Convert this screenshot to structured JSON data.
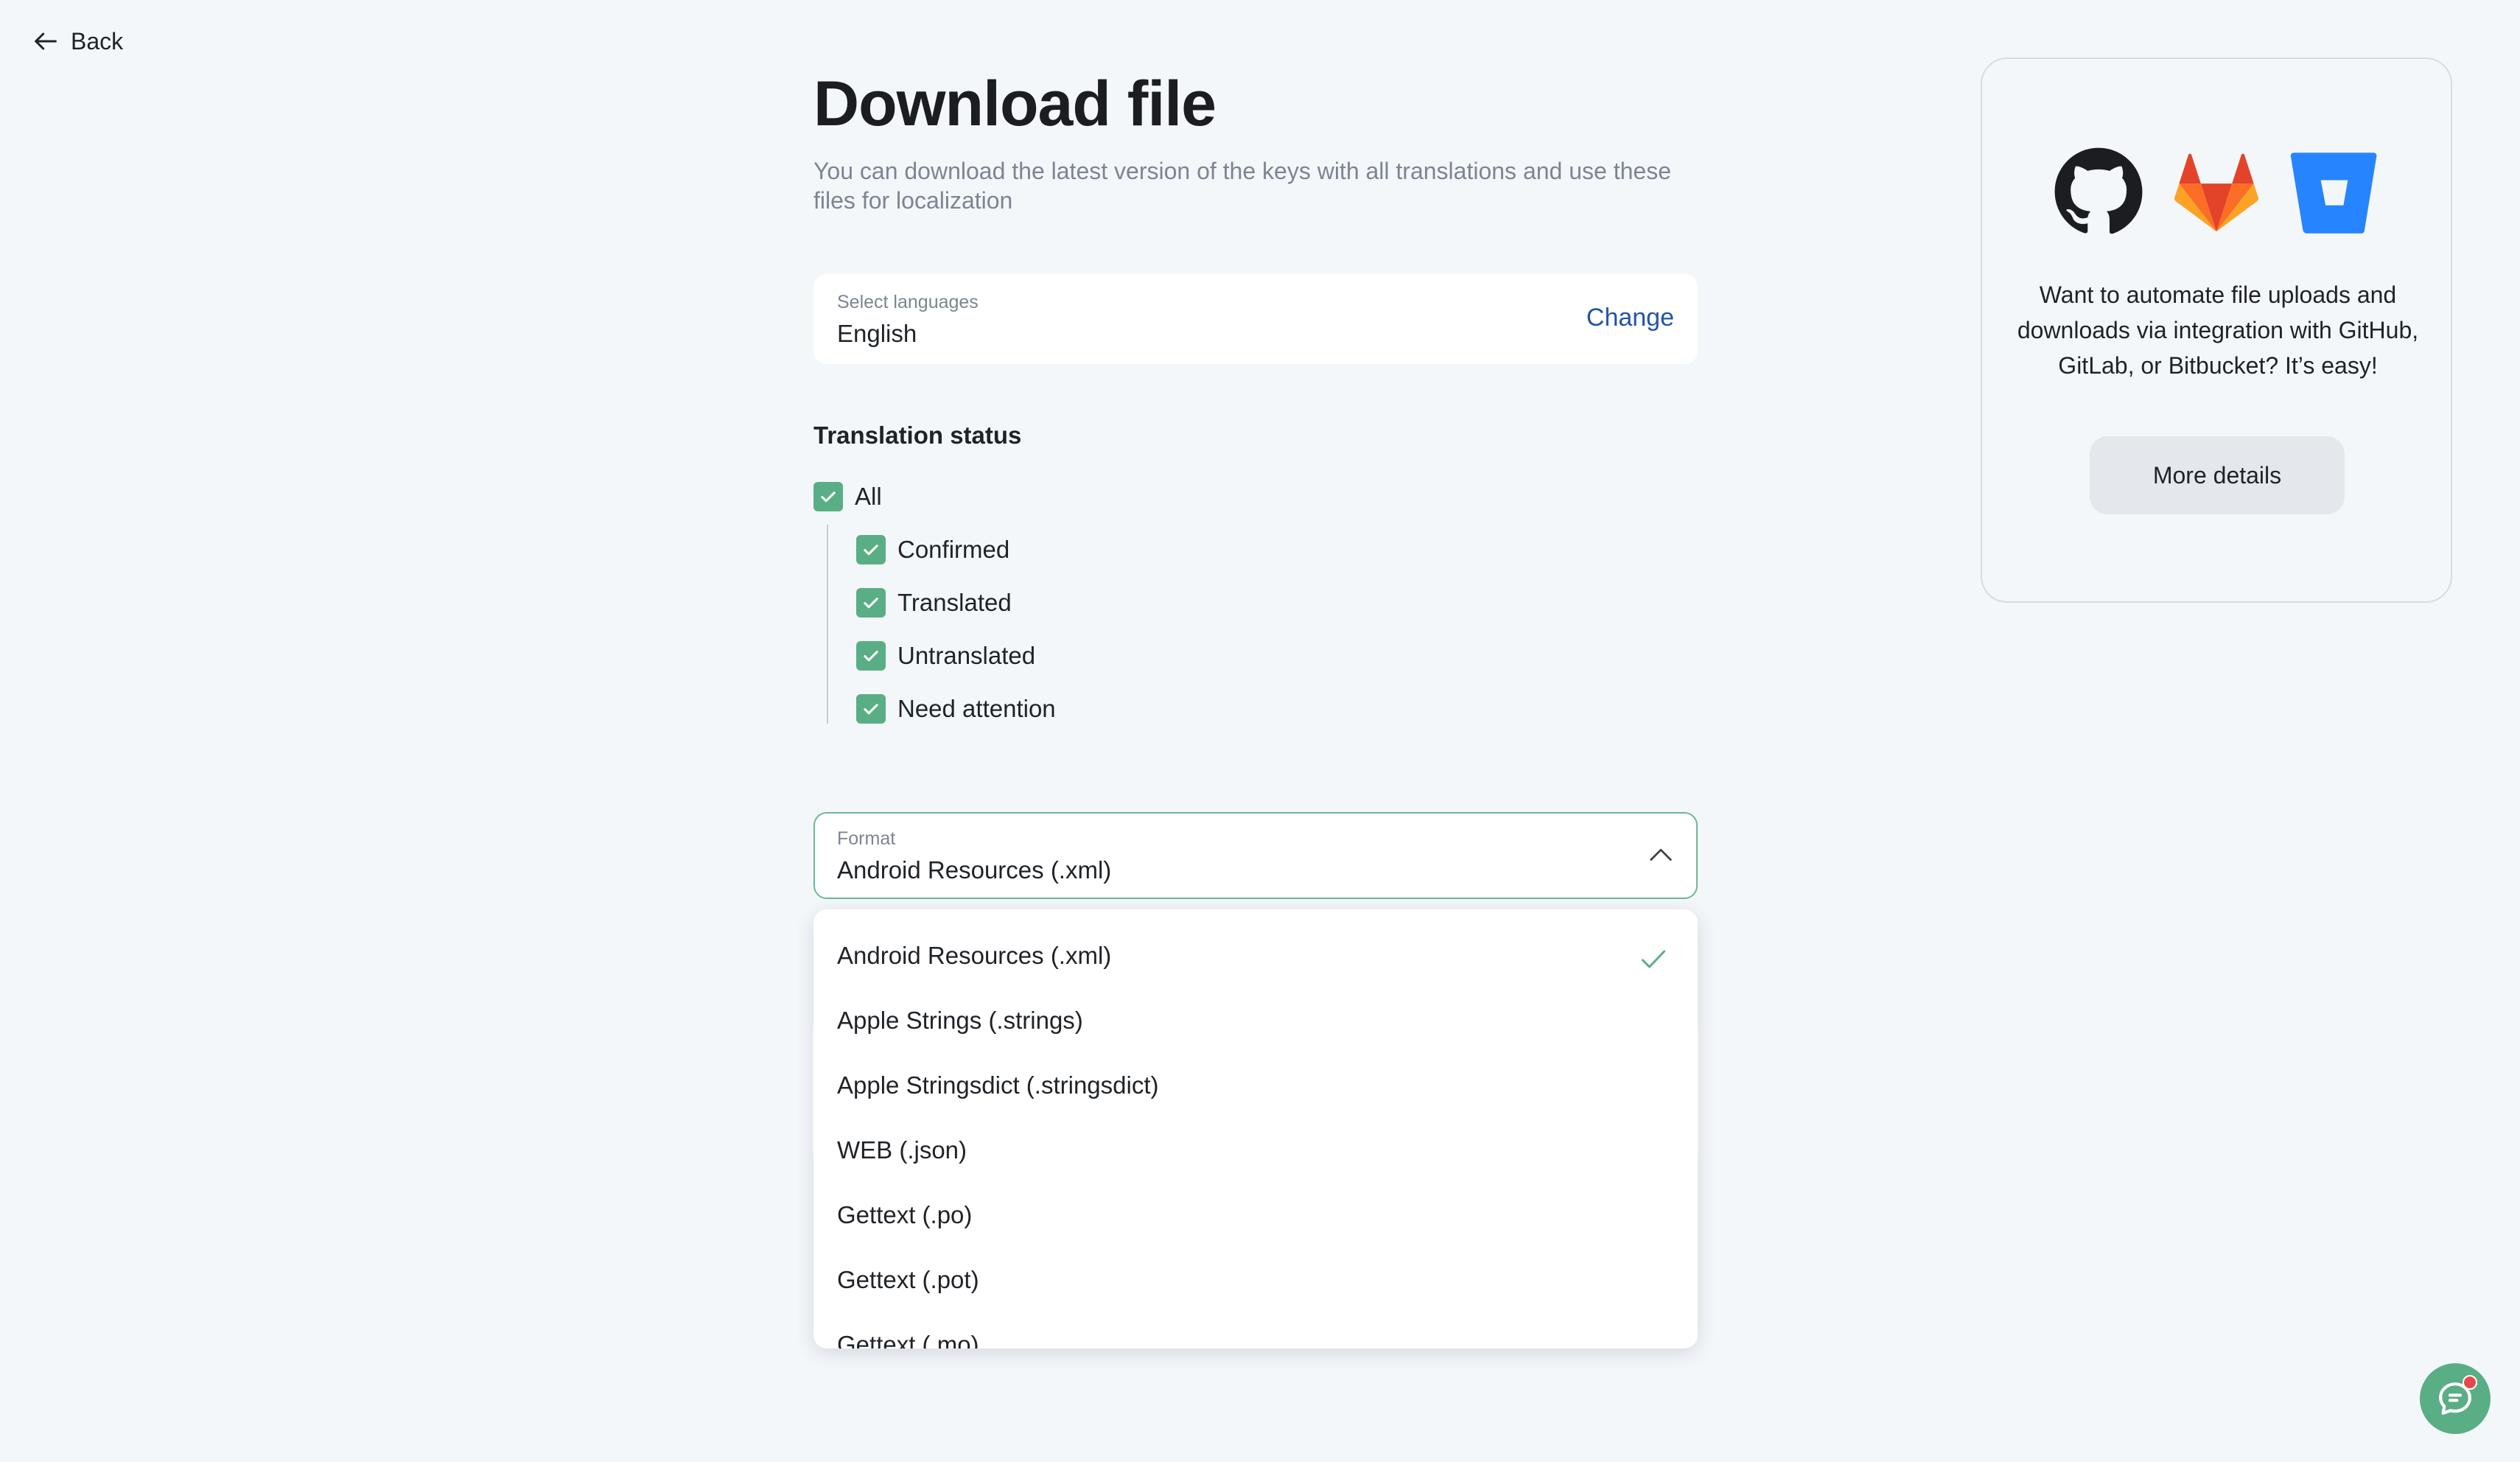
{
  "nav": {
    "back_label": "Back"
  },
  "page": {
    "title": "Download file",
    "subtitle": "You can download the latest version of the keys with all translations and use these files for localization"
  },
  "languages": {
    "label": "Select languages",
    "value": "English",
    "change_label": "Change"
  },
  "translation_status": {
    "heading": "Translation status",
    "all_label": "All",
    "items": [
      {
        "label": "Confirmed",
        "checked": true
      },
      {
        "label": "Translated",
        "checked": true
      },
      {
        "label": "Untranslated",
        "checked": true
      },
      {
        "label": "Need attention",
        "checked": true
      }
    ]
  },
  "format": {
    "label": "Format",
    "value": "Android Resources (.xml)",
    "options": [
      "Android Resources (.xml)",
      "Apple Strings (.strings)",
      "Apple Stringsdict (.stringsdict)",
      "WEB (.json)",
      "Gettext (.po)",
      "Gettext (.pot)",
      "Gettext (.mo)"
    ],
    "selected_index": 0
  },
  "integration_card": {
    "icons": [
      "github-icon",
      "gitlab-icon",
      "bitbucket-icon"
    ],
    "text": "Want to automate file uploads and downloads via integration with GitHub, GitLab, or Bitbucket? It’s easy!",
    "button_label": "More details"
  },
  "colors": {
    "accent_green": "#5aae85",
    "link_blue": "#2454a6",
    "background": "#f4f7fa"
  }
}
